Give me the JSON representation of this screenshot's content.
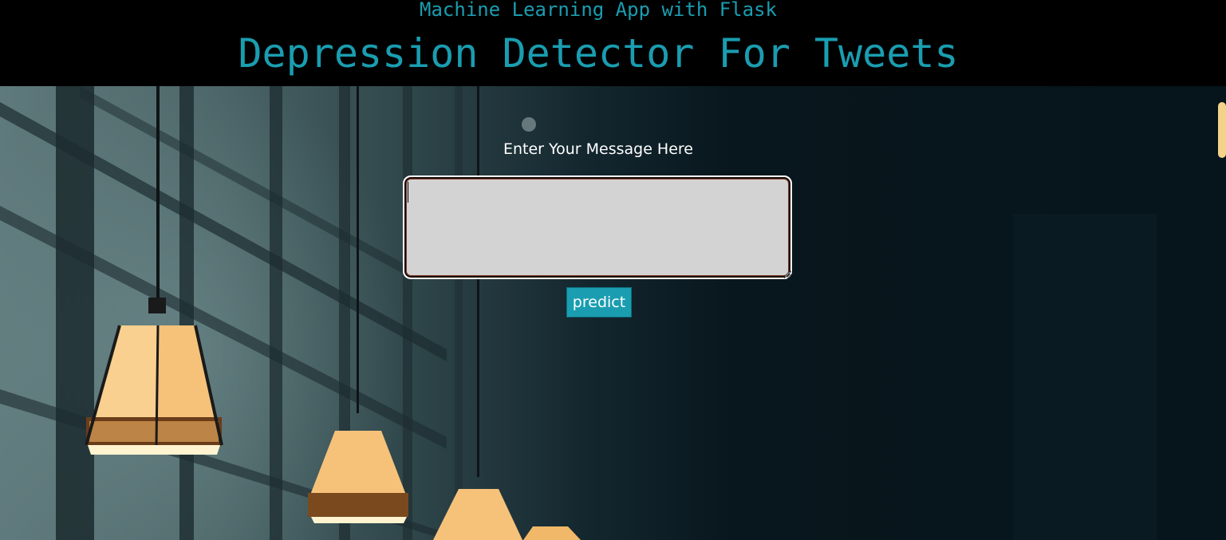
{
  "header": {
    "subtitle": "Machine Learning App with Flask",
    "title": "Depression Detector For Tweets"
  },
  "form": {
    "label": "Enter Your Message Here",
    "message_value": "",
    "submit_label": "predict"
  },
  "colors": {
    "accent": "#1a9db0",
    "header_bg": "#000000",
    "textarea_bg": "#d3d3d3"
  }
}
